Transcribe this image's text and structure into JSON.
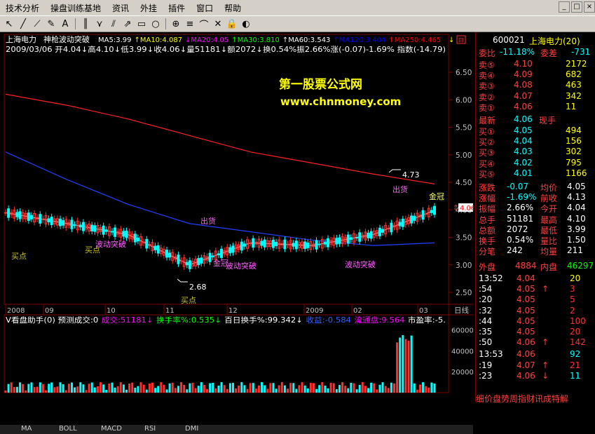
{
  "menu": [
    "技术分析",
    "操盘训练基地",
    "资讯",
    "外挂",
    "插件",
    "窗口",
    "帮助"
  ],
  "window_controls": [
    "_",
    "□",
    "×"
  ],
  "toolbar_icons": [
    "cursor-icon",
    "line-icon",
    "ray-icon",
    "pen-icon",
    "text-icon",
    "bars-icon",
    "fan-icon",
    "channel-icon",
    "arrow-icon",
    "rect-icon",
    "circle-icon",
    "gann-icon",
    "fib-icon",
    "cycle-icon",
    "delete-icon",
    "lock-icon",
    "hide-icon"
  ],
  "chart": {
    "stock_name": "上海电力",
    "indicator_name": "神枪波动突破",
    "ma_line": [
      {
        "text": "MA5:3.99",
        "color": "#ffffff"
      },
      {
        "text": "↑MA10:4.087",
        "color": "#ffff00"
      },
      {
        "text": "↓MA20:4.05",
        "color": "#ff00ff"
      },
      {
        "text": "↑MA30:3.810",
        "color": "#00ff00"
      },
      {
        "text": "↑MA60:3.543",
        "color": "#ffffff"
      },
      {
        "text": "↑MA120:3.404",
        "color": "#0000ff"
      },
      {
        "text": "↑MA250:4.465",
        "color": "#ff0000"
      }
    ],
    "info_line": "2009/03/06  开4.04↓高4.10↓低3.99↓收4.06↓量51181↓额2072↓换0.54%振2.66%涨(-0.07)-1.69% 指数(-14.79)",
    "watermark_title": "第一股票公式网",
    "watermark_url": "www.chnmoney.com",
    "price_axis": [
      "6.50",
      "6.00",
      "5.50",
      "5.00",
      "4.50",
      "4.00",
      "3.50",
      "3.00",
      "2.50"
    ],
    "current_price_tag": "4.06",
    "high_label": "4.73",
    "low_label": "2.68",
    "annotations": [
      "买点",
      "买点",
      "买点",
      "出货",
      "出货",
      "金冠",
      "波动突破",
      "波动突破",
      "波动突破",
      "金冠",
      "出货"
    ],
    "date_axis": [
      "2008",
      "09",
      "10",
      "11",
      "12",
      "2009",
      "02",
      "03"
    ],
    "date_axis_right": "日线",
    "volume_panel": {
      "items": [
        {
          "text": "V看盘助手(0) 预测成交:0",
          "color": "#ffffff"
        },
        {
          "text": "成交:51181↓",
          "color": "#ff00ff"
        },
        {
          "text": "换手率%:0.535↓",
          "color": "#00ff00"
        },
        {
          "text": "百日换手%:99.342↓",
          "color": "#ffffff"
        },
        {
          "text": "收益:-0.584",
          "color": "#3060ff"
        },
        {
          "text": "流通盘:9.564",
          "color": "#ff00ff"
        },
        {
          "text": "市盈率:-5.",
          "color": "#ffffff"
        }
      ],
      "axis": [
        "600000",
        "400000",
        "200000"
      ]
    },
    "bottom_tabs": [
      "MA",
      "BOLL",
      "MACD",
      "RSI",
      "DMI"
    ]
  },
  "chart_data": {
    "type": "line",
    "title": "上海电力",
    "x": [
      "2008-08",
      "2008-09",
      "2008-10",
      "2008-11",
      "2008-12",
      "2009-01",
      "2009-02",
      "2009-03"
    ],
    "series": [
      {
        "name": "MA250",
        "values": [
          6.1,
          5.9,
          5.65,
          5.35,
          5.05,
          4.85,
          4.65,
          4.47
        ]
      },
      {
        "name": "MA120",
        "values": [
          5.05,
          4.55,
          4.1,
          3.75,
          3.6,
          3.45,
          3.35,
          3.4
        ]
      },
      {
        "name": "MA5",
        "values": [
          3.95,
          3.75,
          3.55,
          3.0,
          3.4,
          3.35,
          3.55,
          3.99
        ]
      }
    ],
    "ylim": [
      2.4,
      6.7
    ],
    "volume_ylim": [
      0,
      650000
    ]
  },
  "side": {
    "code": "600021",
    "name": "上海电力(20)",
    "weibi_label": "委比",
    "weibi_value": "-11.18%",
    "weicha_label": "委差",
    "weicha_value": "-731",
    "sell": [
      {
        "label": "卖⑤",
        "price": "4.10",
        "vol": "2172"
      },
      {
        "label": "卖④",
        "price": "4.09",
        "vol": "682"
      },
      {
        "label": "卖③",
        "price": "4.08",
        "vol": "463"
      },
      {
        "label": "卖②",
        "price": "4.07",
        "vol": "342"
      },
      {
        "label": "卖①",
        "price": "4.06",
        "vol": "11"
      }
    ],
    "latest_label": "最新",
    "latest_value": "4.06",
    "xianshou_label": "现手",
    "buy": [
      {
        "label": "买①",
        "price": "4.05",
        "vol": "494"
      },
      {
        "label": "买②",
        "price": "4.04",
        "vol": "156"
      },
      {
        "label": "买③",
        "price": "4.03",
        "vol": "302"
      },
      {
        "label": "买④",
        "price": "4.02",
        "vol": "795"
      },
      {
        "label": "买⑤",
        "price": "4.01",
        "vol": "1166"
      }
    ],
    "stats": [
      {
        "l1": "涨跌",
        "v1": "-0.07",
        "l2": "均价",
        "v2": "4.05"
      },
      {
        "l1": "涨幅",
        "v1": "-1.69%",
        "l2": "前收",
        "v2": "4.13"
      },
      {
        "l1": "振幅",
        "v1": "2.66%",
        "l2": "今开",
        "v2": "4.04"
      },
      {
        "l1": "总手",
        "v1": "51181",
        "l2": "最高",
        "v2": "4.10"
      },
      {
        "l1": "总额",
        "v1": "2072",
        "l2": "最低",
        "v2": "3.99"
      },
      {
        "l1": "换手",
        "v1": "0.54%",
        "l2": "量比",
        "v2": "1.50"
      },
      {
        "l1": "分笔",
        "v1": "242",
        "l2": "均量",
        "v2": "211"
      }
    ],
    "waipan_label": "外盘",
    "waipan_value": "4884",
    "neipan_label": "内盘",
    "neipan_value": "46297",
    "ticks": [
      {
        "t": "13:52",
        "p": "4.04",
        "a": "",
        "v": "20",
        "vc": "#ffff00"
      },
      {
        "t": ":54",
        "p": "4.05",
        "a": "↑",
        "v": "3",
        "vc": "#ff3030"
      },
      {
        "t": ":20",
        "p": "4.05",
        "a": "",
        "v": "5",
        "vc": "#ff3030"
      },
      {
        "t": ":32",
        "p": "4.05",
        "a": "",
        "v": "2",
        "vc": "#ff3030"
      },
      {
        "t": ":44",
        "p": "4.05",
        "a": "",
        "v": "100",
        "vc": "#ff3030"
      },
      {
        "t": ":35",
        "p": "4.05",
        "a": "",
        "v": "20",
        "vc": "#ff3030"
      },
      {
        "t": ":50",
        "p": "4.06",
        "a": "↑",
        "v": "142",
        "vc": "#ff3030"
      },
      {
        "t": "13:53",
        "p": "4.06",
        "a": "",
        "v": "92",
        "vc": "#00ffff"
      },
      {
        "t": ":19",
        "p": "4.07",
        "a": "↑",
        "v": "21",
        "vc": "#ff3030"
      },
      {
        "t": ":23",
        "p": "4.06",
        "a": "↓",
        "v": "11",
        "vc": "#00ffff"
      }
    ],
    "bottom_text": "细价盘势周指财讯成特解"
  }
}
